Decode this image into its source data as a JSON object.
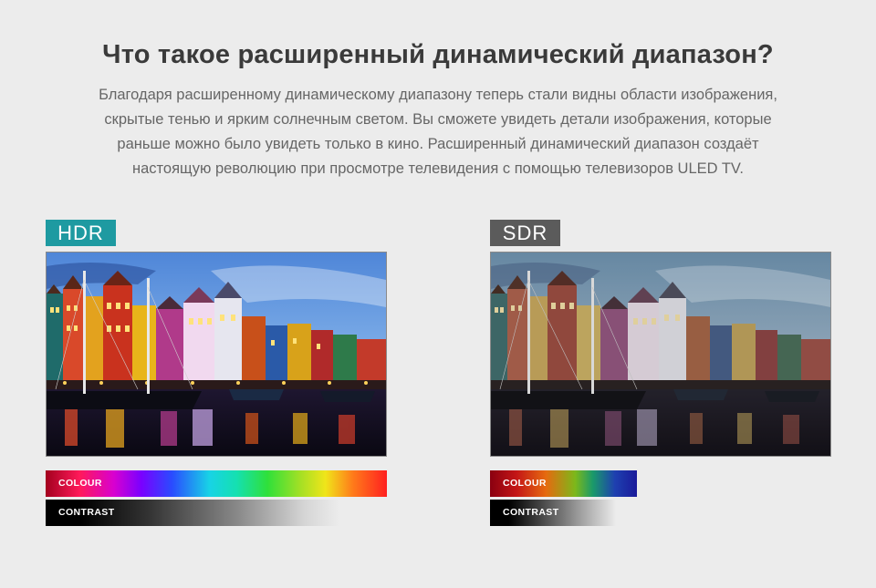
{
  "header": {
    "title": "Что такое расширенный динамический диапазон?",
    "description_lines": [
      "Благодаря расширенному динамическому диапазону теперь стали видны области изображения,",
      "скрытые тенью и ярким солнечным светом. Вы сможете увидеть детали изображения, которые",
      "раньше можно было увидеть только в кино. Расширенный динамический диапазон создаёт",
      "настоящую революцию при просмотре телевидения с помощью телевизоров ULED TV."
    ]
  },
  "panels": {
    "hdr": {
      "label": "HDR",
      "colour_label": "COLOUR",
      "contrast_label": "CONTRAST",
      "colour_range_fraction": 1.0,
      "contrast_range_fraction": 0.86,
      "accent": "#1e9aa1"
    },
    "sdr": {
      "label": "SDR",
      "colour_label": "COLOUR",
      "contrast_label": "CONTRAST",
      "colour_range_fraction": 0.43,
      "contrast_range_fraction": 0.37,
      "accent": "#5b5b5b"
    }
  },
  "image": {
    "subject": "harbor-with-colorful-houses-and-boats"
  }
}
